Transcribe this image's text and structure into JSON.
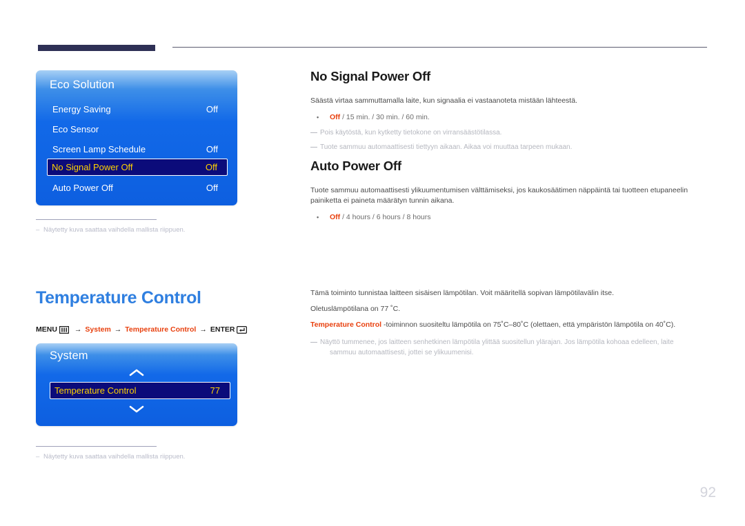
{
  "page_number": "92",
  "sections": [
    {
      "id": "no-signal-power-off",
      "heading": "No Signal Power Off",
      "body": "Säästä virtaa sammuttamalla laite, kun signaalia ei vastaanoteta mistään lähteestä.",
      "options": {
        "first": "Off",
        "rest": " / 15 min. / 30 min. / 60 min."
      },
      "notes": [
        "Pois käytöstä, kun kytketty tietokone on virransäästötilassa.",
        "Tuote sammuu automaattisesti tiettyyn aikaan. Aikaa voi muuttaa tarpeen mukaan."
      ]
    },
    {
      "id": "auto-power-off",
      "heading": "Auto Power Off",
      "body_line1": "Tuote sammuu automaattisesti ylikuumentumisen välttämiseksi, jos kaukosäätimen näppäintä tai tuotteen etupaneelin",
      "body_line2": "painiketta ei paineta määrätyn tunnin aikana.",
      "options": {
        "first": "Off",
        "rest": " / 4 hours / 6 hours / 8 hours"
      }
    }
  ],
  "eco_panel": {
    "title": "Eco Solution",
    "rows": [
      {
        "label": "Energy Saving",
        "value": "Off",
        "selected": false
      },
      {
        "label": "Eco Sensor",
        "value": "",
        "selected": false
      },
      {
        "label": "Screen Lamp Schedule",
        "value": "Off",
        "selected": false
      },
      {
        "label": "No Signal Power Off",
        "value": "Off",
        "selected": true
      },
      {
        "label": "Auto Power Off",
        "value": "Off",
        "selected": false
      }
    ]
  },
  "system_panel": {
    "title": "System",
    "rows": [
      {
        "label": "Temperature Control",
        "value": "77",
        "selected": true
      }
    ],
    "scroll_up_icon": "chevron-up-icon",
    "scroll_down_icon": "chevron-down-icon"
  },
  "footnotes": {
    "first": "Näytetty kuva saattaa vaihdella mallista riippuen.",
    "second": "Näytetty kuva saattaa vaihdella mallista riippuen.",
    "dash": "–"
  },
  "temperature_control": {
    "title": "Temperature Control",
    "breadcrumb": {
      "menu": "MENU",
      "menu_icon": "menu-grid-icon",
      "arrow": "→",
      "step1": "System",
      "step2": "Temperature Control",
      "enter": "ENTER",
      "enter_icon": "enter-key-icon"
    },
    "body1": "Tämä toiminto tunnistaa laitteen sisäisen lämpötilan. Voit määritellä sopivan lämpötilavälin itse.",
    "body2": "Oletuslämpötilana on 77 ˚C.",
    "body3_bold": "Temperature Control",
    "body3_rest": " -toiminnon suositeltu lämpötila on 75˚C–80˚C (olettaen, että ympäristön lämpötila on 40˚C).",
    "note_line1": "Näyttö tummenee, jos laitteen senhetkinen lämpötila ylittää suositellun ylärajan. Jos lämpötila kohoaa edelleen, laite",
    "note_line2": "sammuu automaattisesti, jottei se ylikuumenisi."
  }
}
